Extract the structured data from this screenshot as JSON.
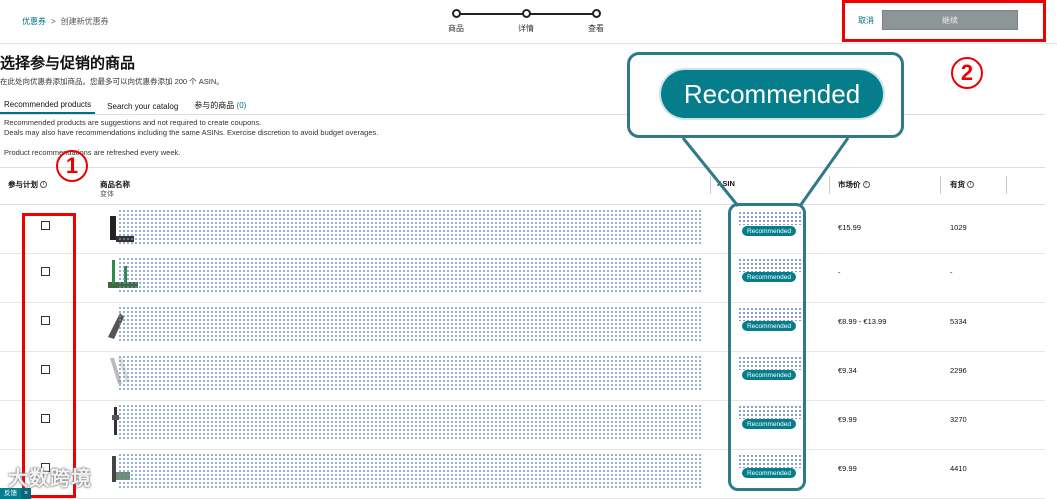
{
  "breadcrumb": {
    "root": "优惠券",
    "current": "创建新优惠券"
  },
  "stepper": {
    "steps": [
      "商品",
      "详情",
      "查看"
    ]
  },
  "header": {
    "cancel": "取消",
    "continue": "继续"
  },
  "page": {
    "title": "选择参与促销的商品",
    "subtitle": "在此处向优惠券添加商品。您最多可以向优惠券添加 200 个 ASIN。"
  },
  "tabs": [
    {
      "label": "Recommended products"
    },
    {
      "label": "Search your catalog"
    },
    {
      "label": "参与的商品",
      "count": "(0)"
    }
  ],
  "notes": {
    "line1": "Recommended products are suggestions and not required to create coupons.",
    "line2": "Deals may also have recommendations including the same ASINs. Exercise discretion to avoid budget overages.",
    "line3": "Product recommendations are refreshed every week."
  },
  "table": {
    "headers": {
      "participate": "参与计划",
      "product": "商品名称",
      "variant": "变体",
      "asin": "ASIN",
      "price": "市场价",
      "stock": "有货"
    },
    "rows": [
      {
        "badge": "Recommended",
        "price": "€15.99",
        "stock": "1029"
      },
      {
        "badge": "Recommended",
        "price": "-",
        "stock": "-"
      },
      {
        "badge": "Recommended",
        "price": "€8.99 - €13.99",
        "stock": "5334"
      },
      {
        "badge": "Recommended",
        "price": "€9.34",
        "stock": "2296"
      },
      {
        "badge": "Recommended",
        "price": "€9.99",
        "stock": "3270"
      },
      {
        "badge": "Recommended",
        "price": "€9.99",
        "stock": "4410"
      }
    ]
  },
  "callout": {
    "label": "Recommended"
  },
  "annotations": {
    "one": "1",
    "two": "2"
  },
  "watermark": "大数跨境",
  "feedback": {
    "label": "反馈",
    "close": "×"
  },
  "colors": {
    "accent": "#067d8b",
    "annotation_red": "#e00000",
    "callout_border": "#2f7a8a"
  }
}
